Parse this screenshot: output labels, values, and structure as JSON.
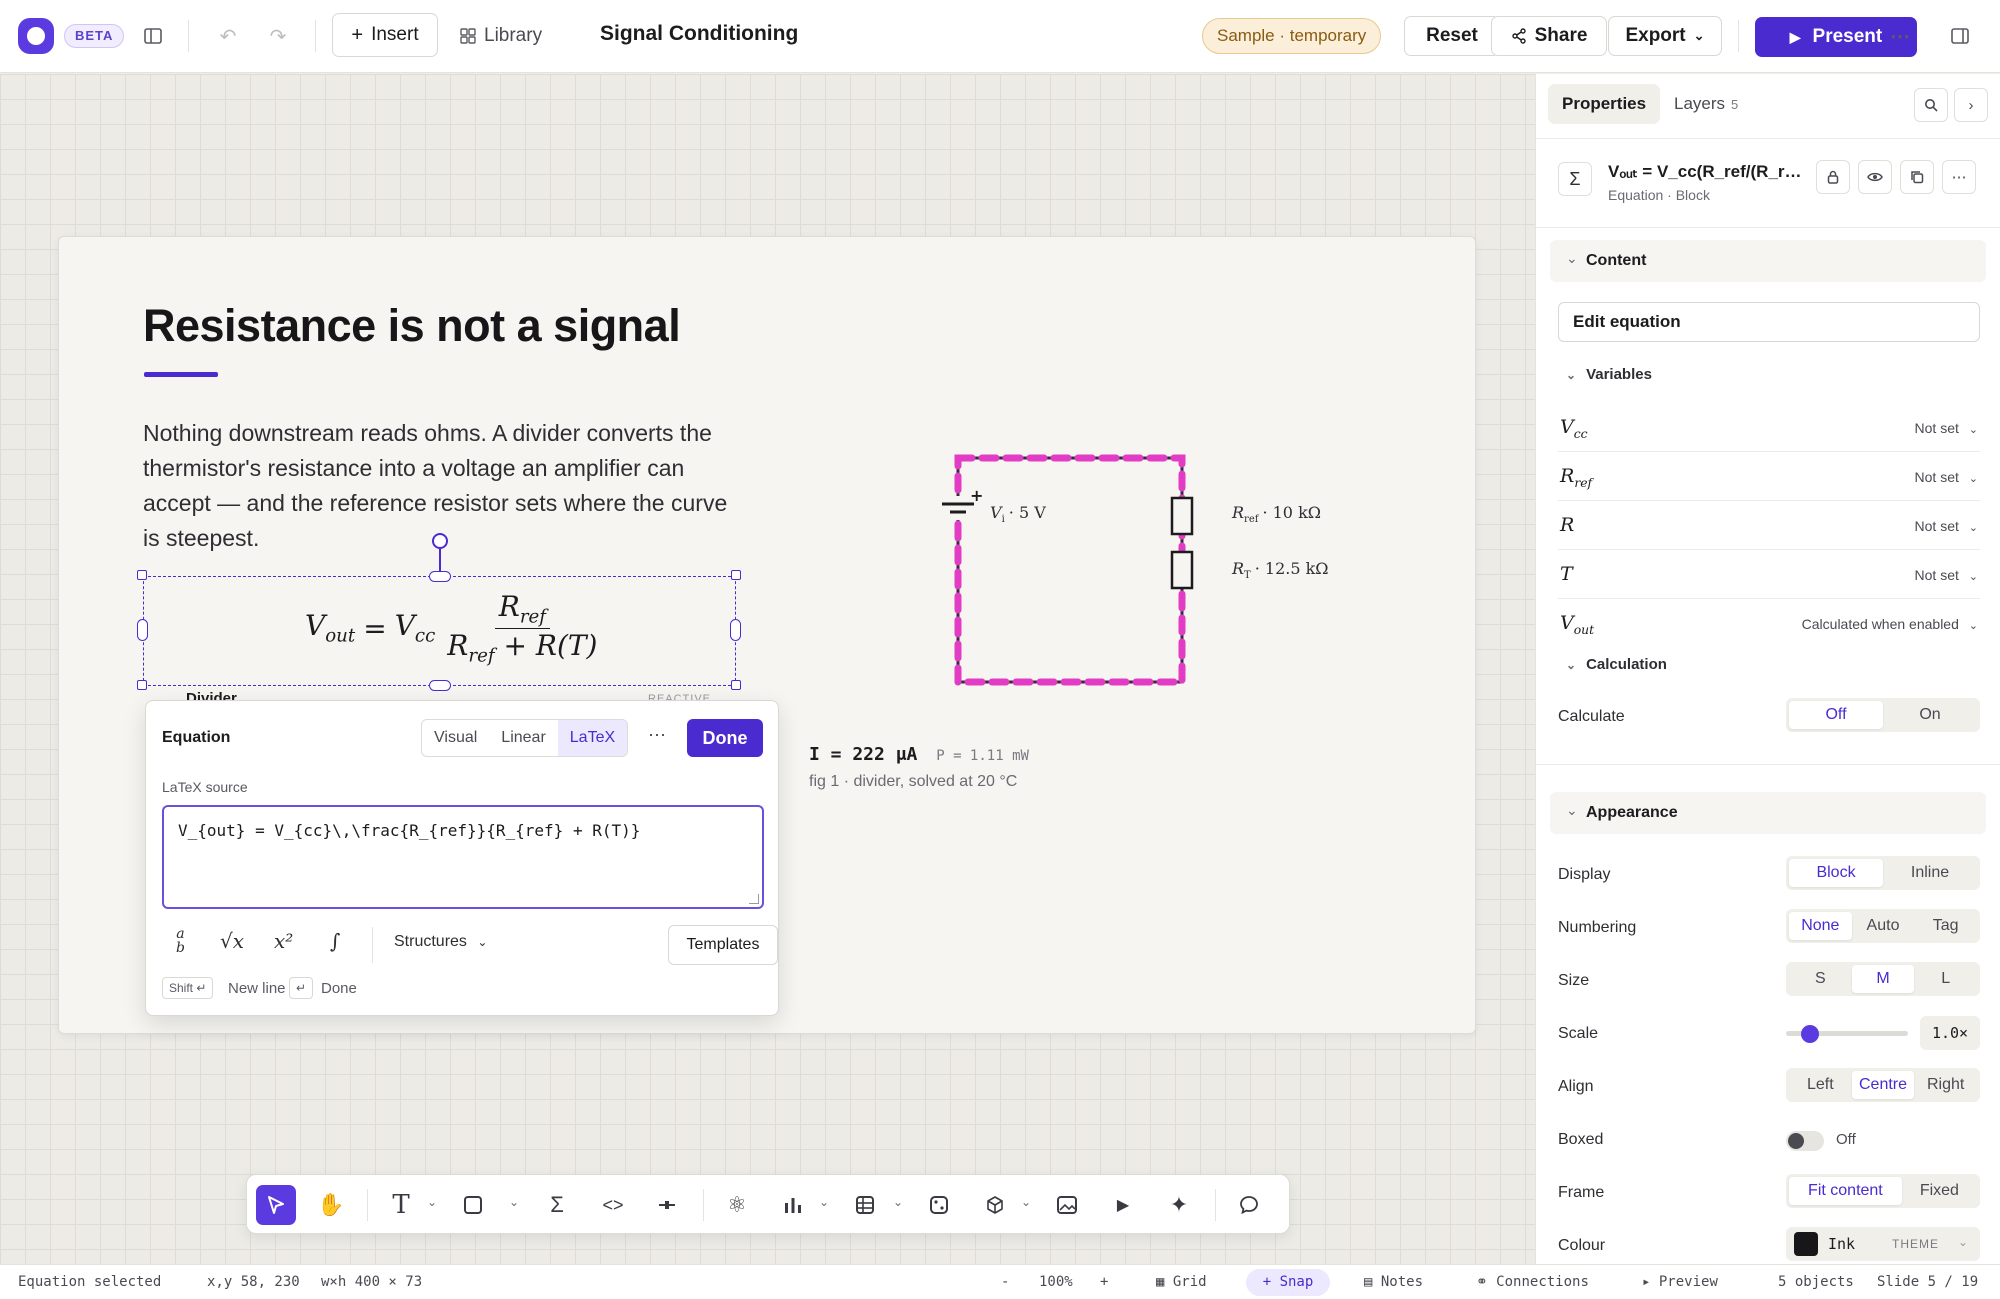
{
  "topbar": {
    "beta_label": "BETA",
    "insert_label": "Insert",
    "library_label": "Library",
    "doc_title": "Signal Conditioning",
    "sample_pill": "Sample · temporary",
    "reset_label": "Reset",
    "share_label": "Share",
    "export_label": "Export",
    "present_label": "Present"
  },
  "slide": {
    "title": "Resistance is not a signal",
    "body": "Nothing downstream reads ohms. A divider converts the thermistor's resistance into a voltage an amplifier can accept — and the reference resistor sets where the curve is steepest.",
    "peek_label": "Divider",
    "peek_tag": "REACTIVE"
  },
  "equation_popover": {
    "title": "Equation",
    "modes": [
      "Visual",
      "Linear",
      "LaTeX"
    ],
    "active_mode": "LaTeX",
    "done_label": "Done",
    "latex_label": "LaTeX source",
    "latex_source": "V_{out} = V_{cc}\\,\\frac{R_{ref}}{R_{ref} + R(T)}",
    "structures_label": "Structures",
    "templates_label": "Templates",
    "shift_key": "Shift ↵",
    "new_line_label": "New line",
    "enter_key": "↵",
    "done_hint": "Done"
  },
  "circuit": {
    "source_label": "V",
    "source_sub": "i",
    "source_value": "· 5 V",
    "rref_label": "R",
    "rref_sub": "ref",
    "rref_value": "· 10 kΩ",
    "rt_label": "R",
    "rt_sub": "T",
    "rt_value": "· 12.5 kΩ",
    "wire_color": "#e23bc4",
    "result_current": "I = 222 μA",
    "result_power": "P = 1.11 mW",
    "caption": "fig 1 · divider, solved at 20 °C"
  },
  "panel": {
    "tab_properties": "Properties",
    "tab_layers": "Layers",
    "layers_count": "5",
    "selection_name": "Vₒᵤₜ = V_cc(R_ref/(R_ref + R(T)))",
    "selection_type": "Equation · Block",
    "content_heading": "Content",
    "edit_equation": "Edit equation",
    "variables_heading": "Variables",
    "variables": [
      {
        "symbol": "V",
        "sub": "cc",
        "value": "Not set"
      },
      {
        "symbol": "R",
        "sub": "ref",
        "value": "Not set"
      },
      {
        "symbol": "R",
        "sub": "",
        "value": "Not set"
      },
      {
        "symbol": "T",
        "sub": "",
        "value": "Not set"
      },
      {
        "symbol": "V",
        "sub": "out",
        "value": "Calculated when enabled"
      }
    ],
    "calculation_heading": "Calculation",
    "calculate_label": "Calculate",
    "calculate_options": [
      "Off",
      "On"
    ],
    "appearance_heading": "Appearance",
    "display_label": "Display",
    "display_options": [
      "Block",
      "Inline"
    ],
    "numbering_label": "Numbering",
    "numbering_options": [
      "None",
      "Auto",
      "Tag"
    ],
    "size_label": "Size",
    "size_options": [
      "S",
      "M",
      "L"
    ],
    "scale_label": "Scale",
    "scale_value": "1.0×",
    "scale_fraction": 0.2,
    "align_label": "Align",
    "align_options": [
      "Left",
      "Centre",
      "Right"
    ],
    "boxed_label": "Boxed",
    "boxed_value": "Off",
    "frame_label": "Frame",
    "frame_options": [
      "Fit content",
      "Fixed"
    ],
    "colour_label": "Colour",
    "colour_name": "Ink",
    "colour_tag": "THEME",
    "colour_hex": "#17171a"
  },
  "statusbar": {
    "selection": "Equation selected",
    "position": "x,y 58, 230",
    "size": "w×h 400 × 73",
    "zoom_out": "-",
    "zoom": "100%",
    "zoom_in": "+",
    "grid": "Grid",
    "snap": "Snap",
    "notes": "Notes",
    "connections": "Connections",
    "preview": "Preview",
    "objects": "5 objects",
    "slide": "Slide 5 / 19"
  },
  "colors": {
    "accent": "#4a2bd0",
    "wire": "#e23bc4"
  }
}
